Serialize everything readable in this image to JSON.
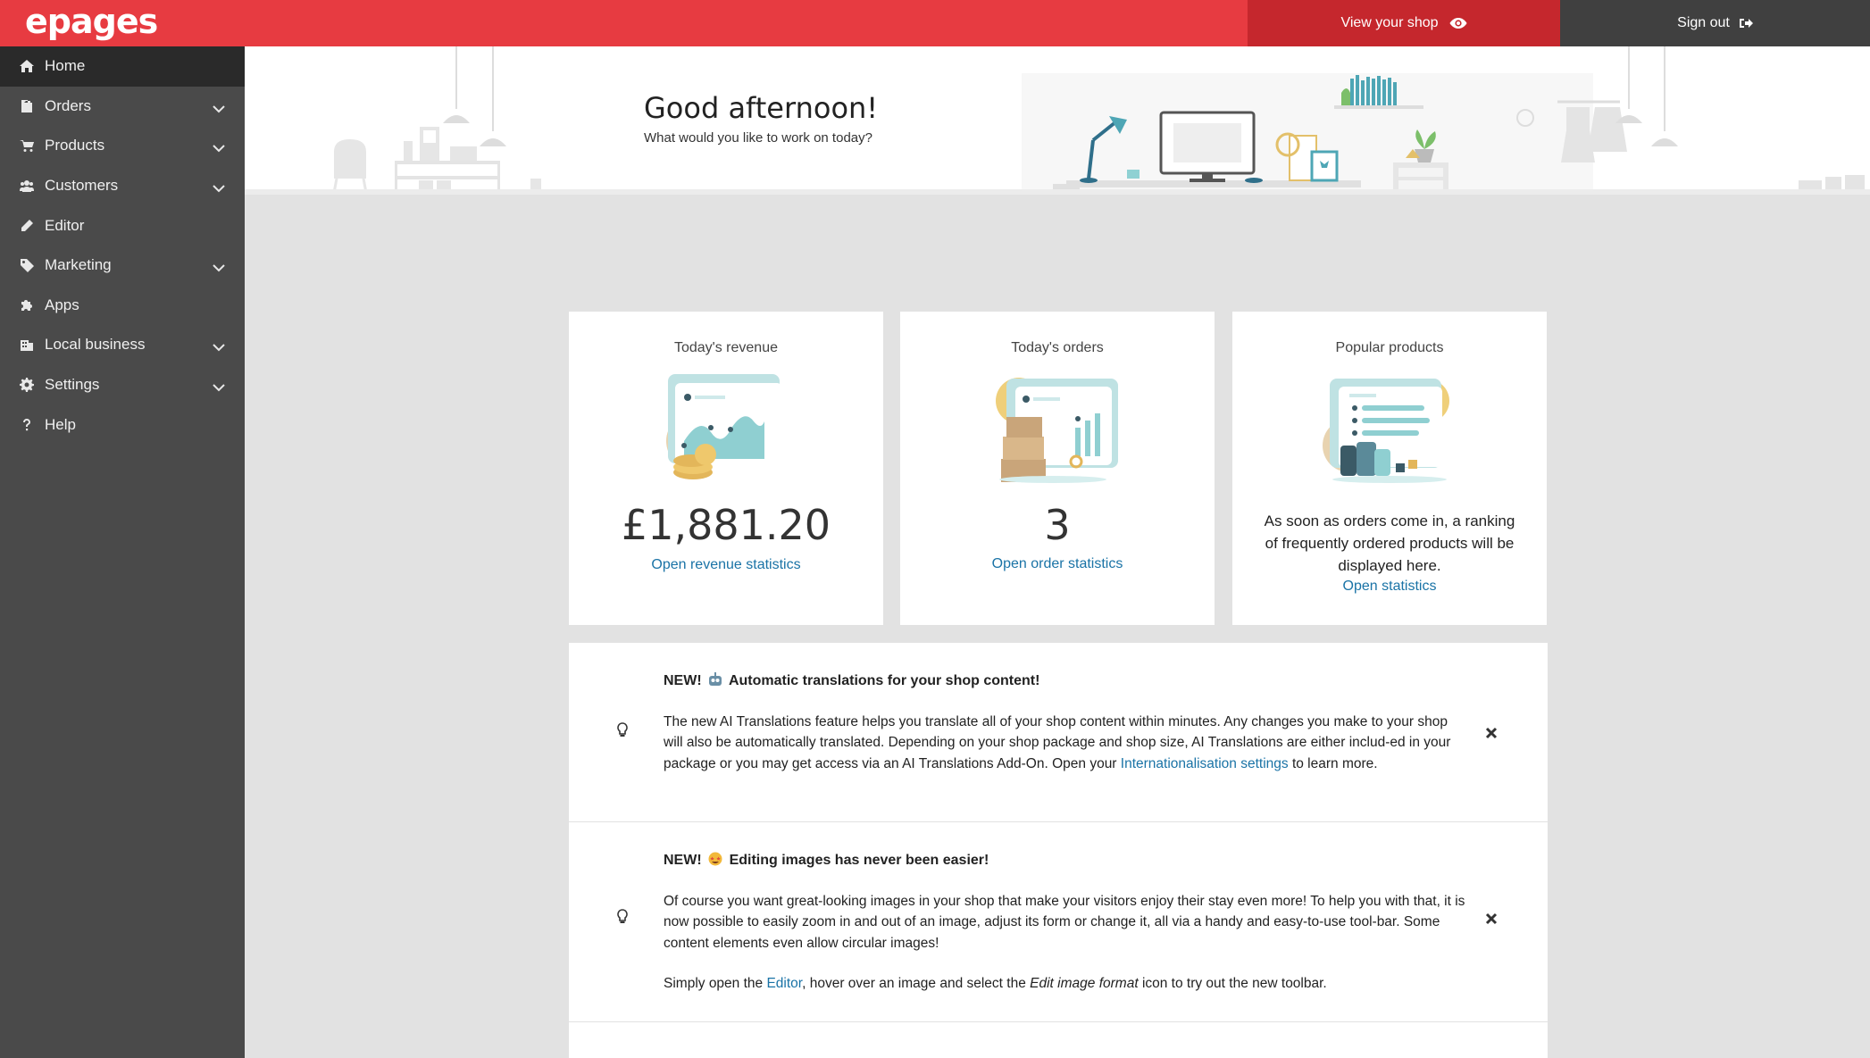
{
  "header": {
    "logo": "epages",
    "view_shop_label": "View your shop",
    "sign_out_label": "Sign out"
  },
  "sidebar": {
    "items": [
      {
        "label": "Home",
        "icon": "home-icon",
        "expandable": false,
        "active": true
      },
      {
        "label": "Orders",
        "icon": "orders-icon",
        "expandable": true
      },
      {
        "label": "Products",
        "icon": "cart-icon",
        "expandable": true
      },
      {
        "label": "Customers",
        "icon": "users-icon",
        "expandable": true
      },
      {
        "label": "Editor",
        "icon": "pencil-icon",
        "expandable": false
      },
      {
        "label": "Marketing",
        "icon": "tag-icon",
        "expandable": true
      },
      {
        "label": "Apps",
        "icon": "puzzle-icon",
        "expandable": false
      },
      {
        "label": "Local business",
        "icon": "building-icon",
        "expandable": true
      },
      {
        "label": "Settings",
        "icon": "gear-icon",
        "expandable": true
      },
      {
        "label": "Help",
        "icon": "question-icon",
        "expandable": false
      }
    ]
  },
  "greeting": {
    "title": "Good afternoon!",
    "subtitle": "What would you like to work on today?"
  },
  "cards": {
    "revenue": {
      "title": "Today's revenue",
      "value": "£1,881.20",
      "link": "Open revenue statistics"
    },
    "orders": {
      "title": "Today's orders",
      "value": "3",
      "link": "Open order statistics"
    },
    "popular": {
      "title": "Popular products",
      "text": "As soon as orders come in, a ranking of frequently ordered products will be displayed here.",
      "link": "Open statistics"
    }
  },
  "notices": [
    {
      "title_prefix": "NEW!",
      "title_text": "Automatic translations for your shop content!",
      "body_1": "The new AI Translations feature helps you translate all of your shop content within minutes. Any changes you make to your shop will also be automatically translated. Depending on your shop package and shop size, AI Translations are either includ-ed in your package or you may get access via an AI Translations Add-On. Open your",
      "link": "Internationalisation settings",
      "body_2": "to learn more."
    },
    {
      "title_prefix": "NEW!",
      "title_text": "Editing images has never been easier!",
      "body_1": "Of course you want great-looking images in your shop that make your visitors enjoy their stay even more! To help you with that, it is now possible to easily zoom in and out of an image, adjust its form or change it, all via a handy and easy-to-use tool-bar. Some content elements even allow circular images!",
      "body_2a": "Simply open the",
      "link": "Editor",
      "body_2b": ", hover over an image and select the",
      "body_2c": "Edit image format",
      "body_2d": "icon to try out the new toolbar."
    }
  ]
}
